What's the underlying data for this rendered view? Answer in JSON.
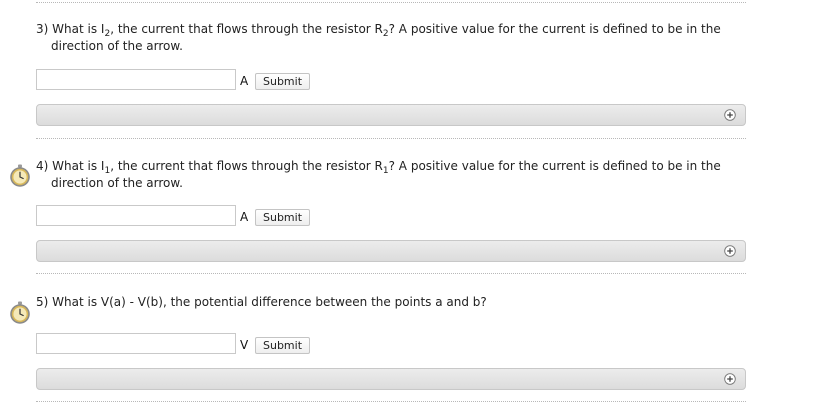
{
  "questions": [
    {
      "number": "3)",
      "line1_a": "What is I",
      "line1_sub1": "2",
      "line1_b": ", the current that flows through the resistor R",
      "line1_sub2": "2",
      "line1_c": "? A positive value for the current is defined to be in the",
      "line2": "direction of the arrow.",
      "unit": "A",
      "submit_label": "Submit",
      "input_value": "",
      "has_timer": false
    },
    {
      "number": "4)",
      "line1_a": "What is I",
      "line1_sub1": "1",
      "line1_b": ", the current that flows through the resistor R",
      "line1_sub2": "1",
      "line1_c": "? A positive value for the current is defined to be in the",
      "line2": "direction of the arrow.",
      "unit": "A",
      "submit_label": "Submit",
      "input_value": "",
      "has_timer": true
    },
    {
      "number": "5)",
      "line1_a": "What is V(a) - V(b), the potential difference between the points a and b?",
      "unit": "V",
      "submit_label": "Submit",
      "input_value": "",
      "has_timer": true
    }
  ],
  "icons": {
    "expand": "plus-circle-icon",
    "timer": "stopwatch-icon"
  },
  "colors": {
    "hint_bar_top": "#ececec",
    "hint_bar_bottom": "#dcdcdc",
    "timer_face": "#f5e9b8",
    "timer_ring": "#d8b85a"
  }
}
